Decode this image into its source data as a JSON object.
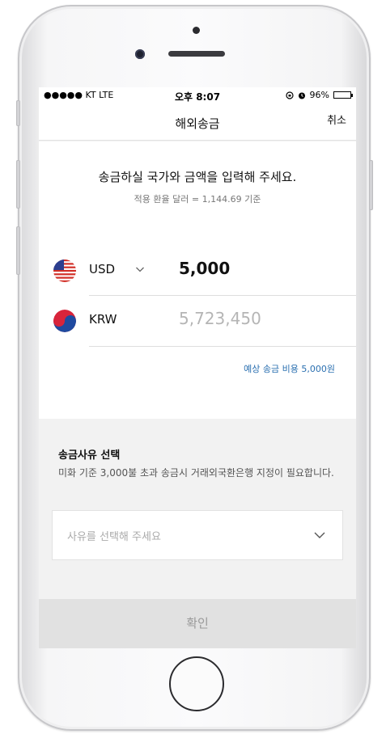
{
  "status": {
    "carrier": "●●●●● KT  LTE",
    "time": "오후 8:07",
    "battery": "96%",
    "battery_level": 0.96
  },
  "nav": {
    "title": "해외송금",
    "cancel": "취소"
  },
  "transfer": {
    "headline": "송금하실 국가와 금액을 입력해 주세요.",
    "rate_info": "적용 환율 달러 = 1,144.69 기준",
    "send": {
      "currency": "USD",
      "amount": "5,000",
      "flag": "us-flag-icon"
    },
    "receive": {
      "currency": "KRW",
      "amount": "5,723,450",
      "flag": "kr-flag-icon"
    },
    "fee": "예상 송금 비용 5,000원"
  },
  "reason": {
    "title": "송금사유 선택",
    "description": "미화 기준 3,000불 초과 송금시 거래외국환은행 지정이 필요합니다.",
    "placeholder": "사유를 선택해 주세요"
  },
  "confirm": {
    "label": "확인"
  },
  "colors": {
    "accent_link": "#2a6fb0",
    "disabled_button": "#e1e1e1",
    "disabled_text": "#9a9a9a",
    "placeholder": "#aaaaaa"
  }
}
